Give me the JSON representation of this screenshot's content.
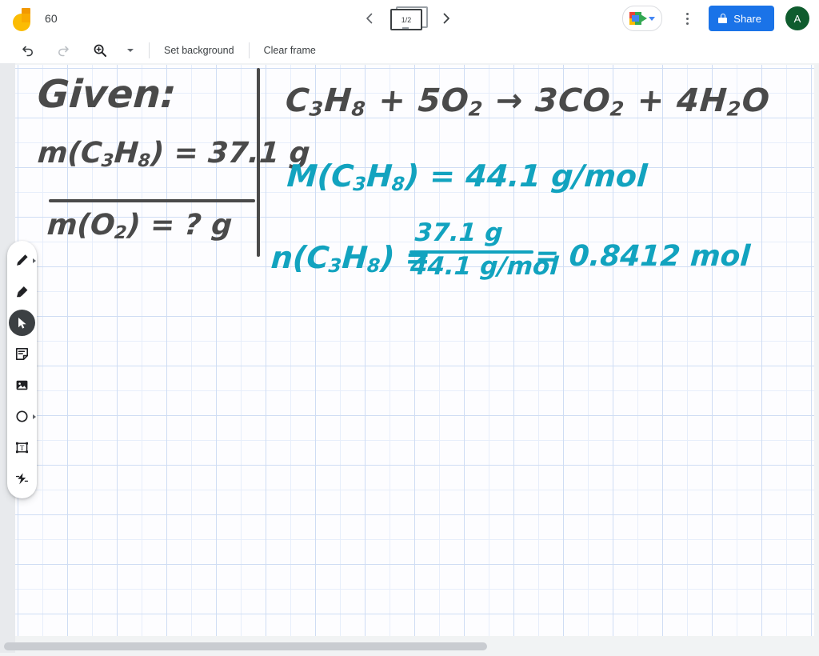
{
  "app": {
    "name": "Jamboard",
    "logo_icon": "jamboard-logo-icon"
  },
  "header": {
    "title": "60",
    "frame_nav": {
      "prev_icon": "chevron-left-icon",
      "next_icon": "chevron-right-icon",
      "counter": "1/2",
      "frames_icon": "frames-stack-icon"
    },
    "meet": {
      "icon": "google-meet-icon",
      "caret_icon": "chevron-down-icon"
    },
    "more_icon": "kebab-menu-icon",
    "share": {
      "label": "Share",
      "lock_icon": "lock-icon",
      "color": "#1a73e8"
    },
    "avatar": {
      "initial": "A",
      "color": "#0f5c2e"
    }
  },
  "toolbar": {
    "undo_icon": "undo-icon",
    "redo_icon": "redo-icon",
    "zoom_icon": "zoom-in-icon",
    "zoom_caret_icon": "chevron-down-icon",
    "set_background_label": "Set background",
    "clear_frame_label": "Clear frame"
  },
  "toolbox": {
    "items": [
      {
        "name": "pen-tool",
        "icon": "pen-icon",
        "active": false,
        "has_caret": true
      },
      {
        "name": "eraser-tool",
        "icon": "eraser-icon",
        "active": false,
        "has_caret": false
      },
      {
        "name": "select-tool",
        "icon": "cursor-arrow-icon",
        "active": true,
        "has_caret": false
      },
      {
        "name": "sticky-note-tool",
        "icon": "sticky-note-icon",
        "active": false,
        "has_caret": false
      },
      {
        "name": "image-tool",
        "icon": "image-icon",
        "active": false,
        "has_caret": false
      },
      {
        "name": "shape-tool",
        "icon": "circle-shape-icon",
        "active": false,
        "has_caret": true
      },
      {
        "name": "text-box-tool",
        "icon": "text-box-icon",
        "active": false,
        "has_caret": false
      },
      {
        "name": "laser-tool",
        "icon": "laser-pointer-icon",
        "active": false,
        "has_caret": false
      }
    ]
  },
  "canvas": {
    "background": "grid-paper",
    "grid_color": "#cfddf4",
    "ink_dark": "#4a4a4a",
    "ink_teal": "#12a3bf",
    "notes": {
      "given_label": "Given:",
      "given_mass_propane": {
        "prefix": "m(C",
        "sub1": "3",
        "mid": "H",
        "sub2": "8",
        "suffix": ") = 37.1 g"
      },
      "unknown_mass_oxygen": {
        "prefix": "m(O",
        "sub1": "2",
        "suffix": ") = ?  g"
      },
      "equation": {
        "reactant1": "C",
        "reactant1_sub1": "3",
        "reactant1_mid": "H",
        "reactant1_sub2": "8",
        "plus1": "+",
        "reactant2": "5O",
        "reactant2_sub": "2",
        "arrow": "→",
        "product1": "3CO",
        "product1_sub": "2",
        "plus2": "+",
        "product2": "4H",
        "product2_sub": "2",
        "product2_end": "O"
      },
      "molar_mass": {
        "prefix": "M(C",
        "sub1": "3",
        "mid": "H",
        "sub2": "8",
        "suffix": ") = 44.1 g/mol"
      },
      "moles": {
        "lhs_prefix": "n(C",
        "lhs_sub1": "3",
        "lhs_mid": "H",
        "lhs_sub2": "8",
        "lhs_suffix": ") =",
        "numerator": "37.1 g",
        "denominator": "44.1 g/mol",
        "result": "= 0.8412 mol"
      }
    }
  },
  "scrollbar": {
    "orientation": "horizontal",
    "thumb_name": "horizontal-scrollbar-thumb"
  }
}
